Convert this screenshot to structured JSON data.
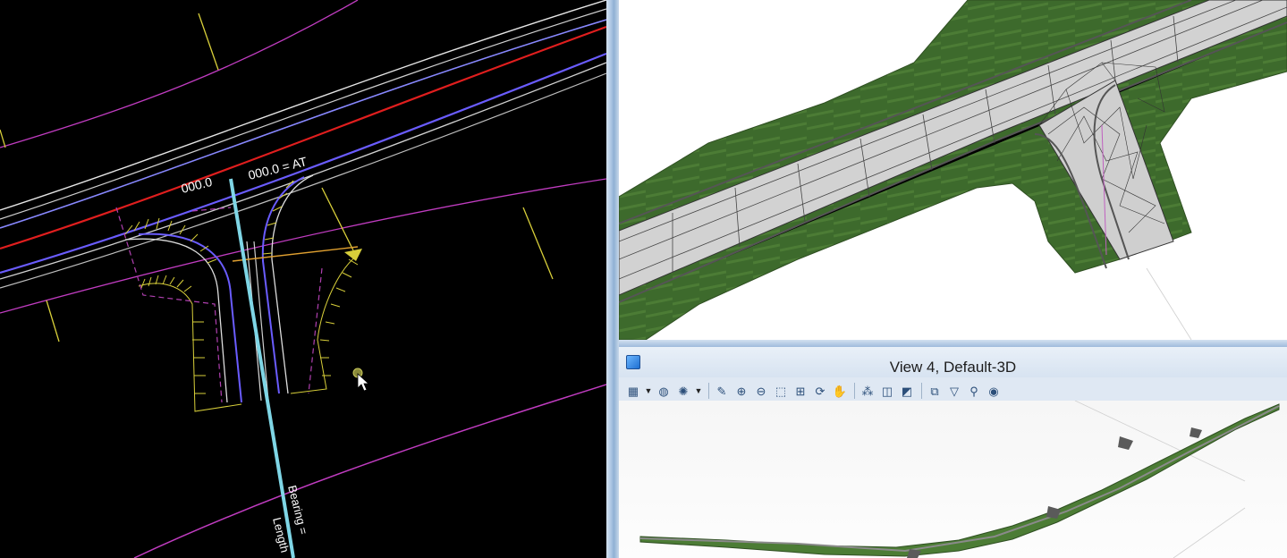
{
  "plan_view": {
    "station_label_left": "000.0",
    "station_label_right": "000.0 = AT",
    "bearing_label": "Bearing =",
    "length_label": "Length"
  },
  "view4": {
    "title": "View 4, Default-3D",
    "toolbar_icons": [
      "view-attributes-icon",
      "dropdown-arrow-icon",
      "display-style-icon",
      "lighting-icon",
      "dropdown-arrow-icon",
      "update-view-icon",
      "zoom-in-icon",
      "zoom-out-icon",
      "window-area-icon",
      "fit-view-icon",
      "rotate-view-icon",
      "pan-view-icon",
      "walk-icon",
      "view-previous-icon",
      "view-next-icon",
      "clip-volume-icon",
      "clip-mask-icon",
      "camera-icon",
      "render-icon"
    ]
  },
  "colors": {
    "plan_background": "#000000",
    "alignment_red": "#e01e1e",
    "edge_blue": "#6a5cff",
    "terrain_green": "#3d6a2c",
    "pavement_gray": "#d2d2d2",
    "centerline_cyan": "#7fd6e6",
    "boundary_magenta": "#c03cc0"
  }
}
